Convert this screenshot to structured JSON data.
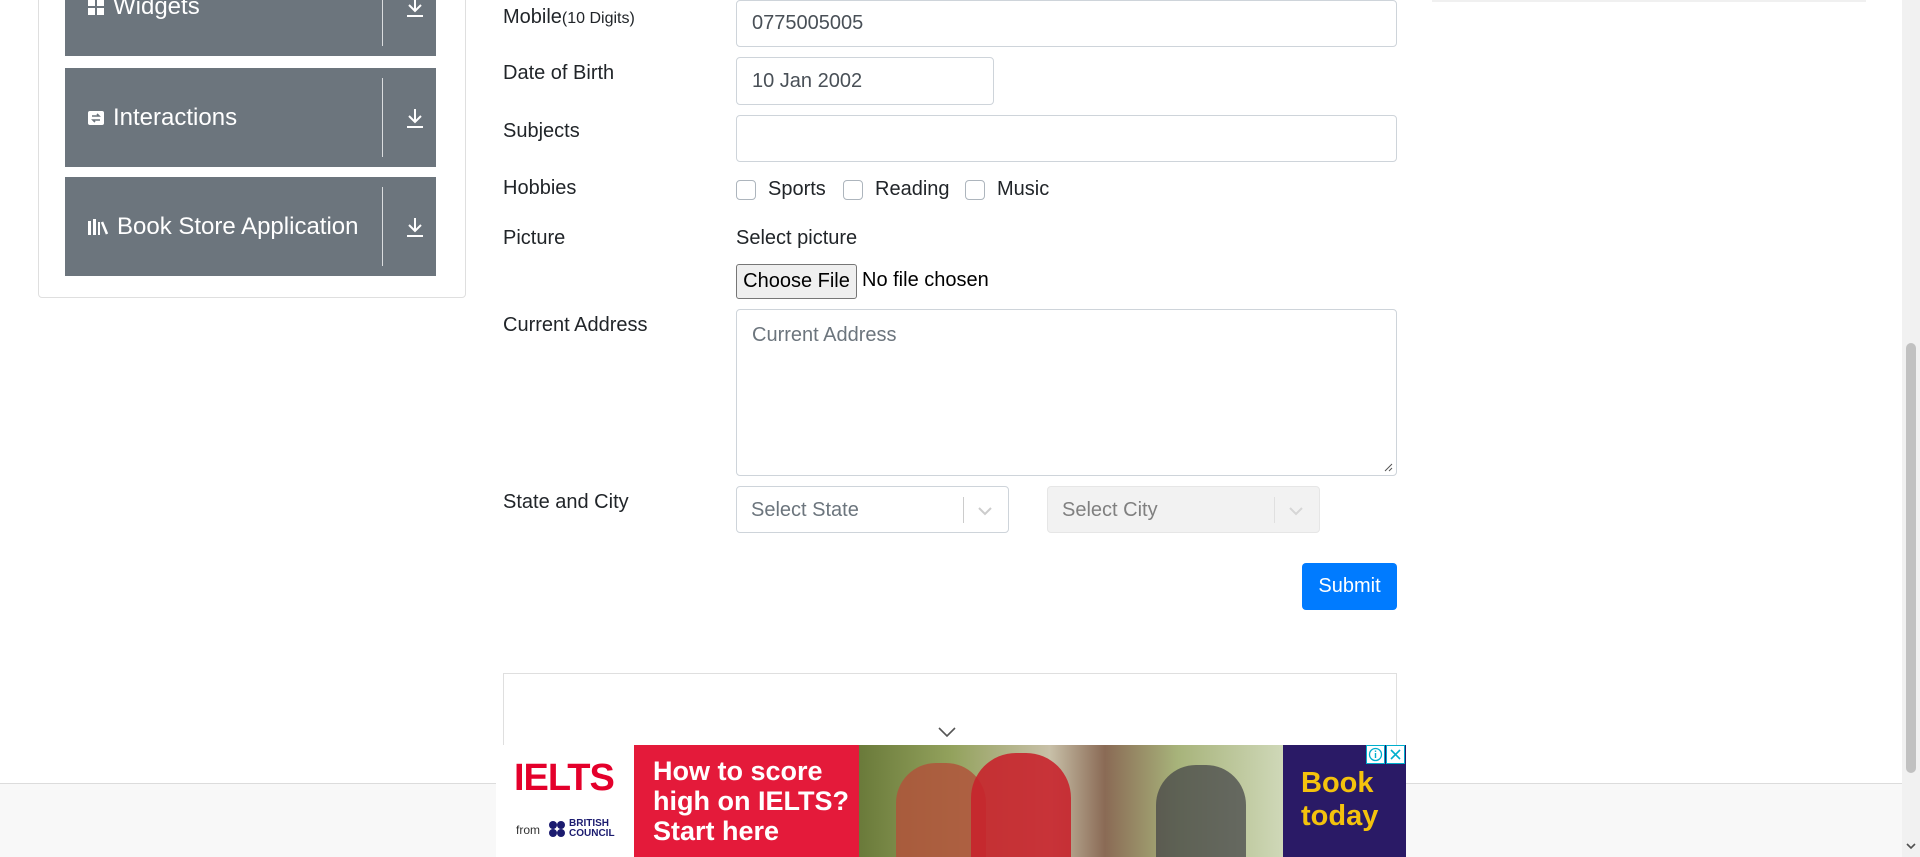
{
  "sidebar": {
    "items": [
      {
        "label": "Widgets",
        "icon": "widgets-icon"
      },
      {
        "label": "Interactions",
        "icon": "interactions-icon"
      },
      {
        "label": "Book Store Application",
        "icon": "book-store-icon"
      }
    ]
  },
  "form": {
    "mobile": {
      "label": "Mobile",
      "hint": "(10 Digits)",
      "value": "0775005005"
    },
    "dob": {
      "label": "Date of Birth",
      "value": "10 Jan 2002"
    },
    "subjects": {
      "label": "Subjects",
      "value": ""
    },
    "hobbies": {
      "label": "Hobbies",
      "options": [
        "Sports",
        "Reading",
        "Music"
      ]
    },
    "picture": {
      "label": "Picture",
      "select_label": "Select picture",
      "button": "Choose File",
      "status": "No file chosen"
    },
    "address": {
      "label": "Current Address",
      "placeholder": "Current Address"
    },
    "state_city": {
      "label": "State and City",
      "state_placeholder": "Select State",
      "city_placeholder": "Select City"
    },
    "submit": "Submit"
  },
  "ad": {
    "brand": "IELTS",
    "from": "from",
    "partner": "BRITISH COUNCIL",
    "headline": "How to score high on IELTS? Start here",
    "cta": "Book today"
  },
  "colors": {
    "primary": "#007bff",
    "sidebar": "#6c757d",
    "ad_red": "#e41a3a",
    "ad_navy": "#2a1a66",
    "ad_yellow": "#f4c20d"
  }
}
